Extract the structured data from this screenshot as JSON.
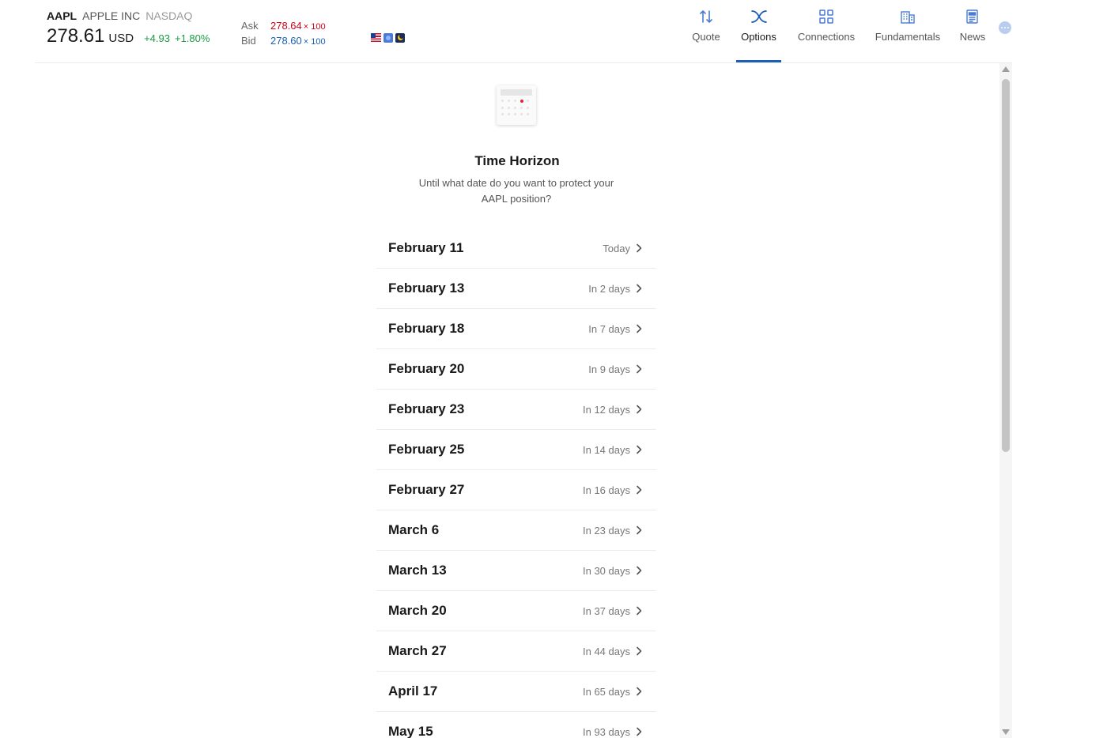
{
  "header": {
    "symbol": "AAPL",
    "company": "APPLE INC",
    "exchange": "NASDAQ",
    "price": "278.61",
    "currency": "USD",
    "change": "+4.93",
    "change_pct": "+1.80%",
    "ask_label": "Ask",
    "ask_price": "278.64",
    "ask_size": "× 100",
    "bid_label": "Bid",
    "bid_price": "278.60",
    "bid_size": "× 100"
  },
  "nav": {
    "tabs": [
      {
        "label": "Quote",
        "icon": "arrows-up-down-icon"
      },
      {
        "label": "Options",
        "icon": "options-cross-icon",
        "active": true
      },
      {
        "label": "Connections",
        "icon": "grid-icon"
      },
      {
        "label": "Fundamentals",
        "icon": "building-icon"
      },
      {
        "label": "News",
        "icon": "newspaper-icon"
      }
    ]
  },
  "content": {
    "title": "Time Horizon",
    "subtitle": "Until what date do you want to protect your AAPL position?",
    "dates": [
      {
        "date": "February 11",
        "relative": "Today"
      },
      {
        "date": "February 13",
        "relative": "In 2 days"
      },
      {
        "date": "February 18",
        "relative": "In 7 days"
      },
      {
        "date": "February 20",
        "relative": "In 9 days"
      },
      {
        "date": "February 23",
        "relative": "In 12 days"
      },
      {
        "date": "February 25",
        "relative": "In 14 days"
      },
      {
        "date": "February 27",
        "relative": "In 16 days"
      },
      {
        "date": "March 6",
        "relative": "In 23 days"
      },
      {
        "date": "March 13",
        "relative": "In 30 days"
      },
      {
        "date": "March 20",
        "relative": "In 37 days"
      },
      {
        "date": "March 27",
        "relative": "In 44 days"
      },
      {
        "date": "April 17",
        "relative": "In 65 days"
      },
      {
        "date": "May 15",
        "relative": "In 93 days"
      }
    ]
  },
  "colors": {
    "accent": "#1a5fb4",
    "ask": "#d0021b",
    "positive": "#1a9b44",
    "icon": "#4a7bd4"
  }
}
